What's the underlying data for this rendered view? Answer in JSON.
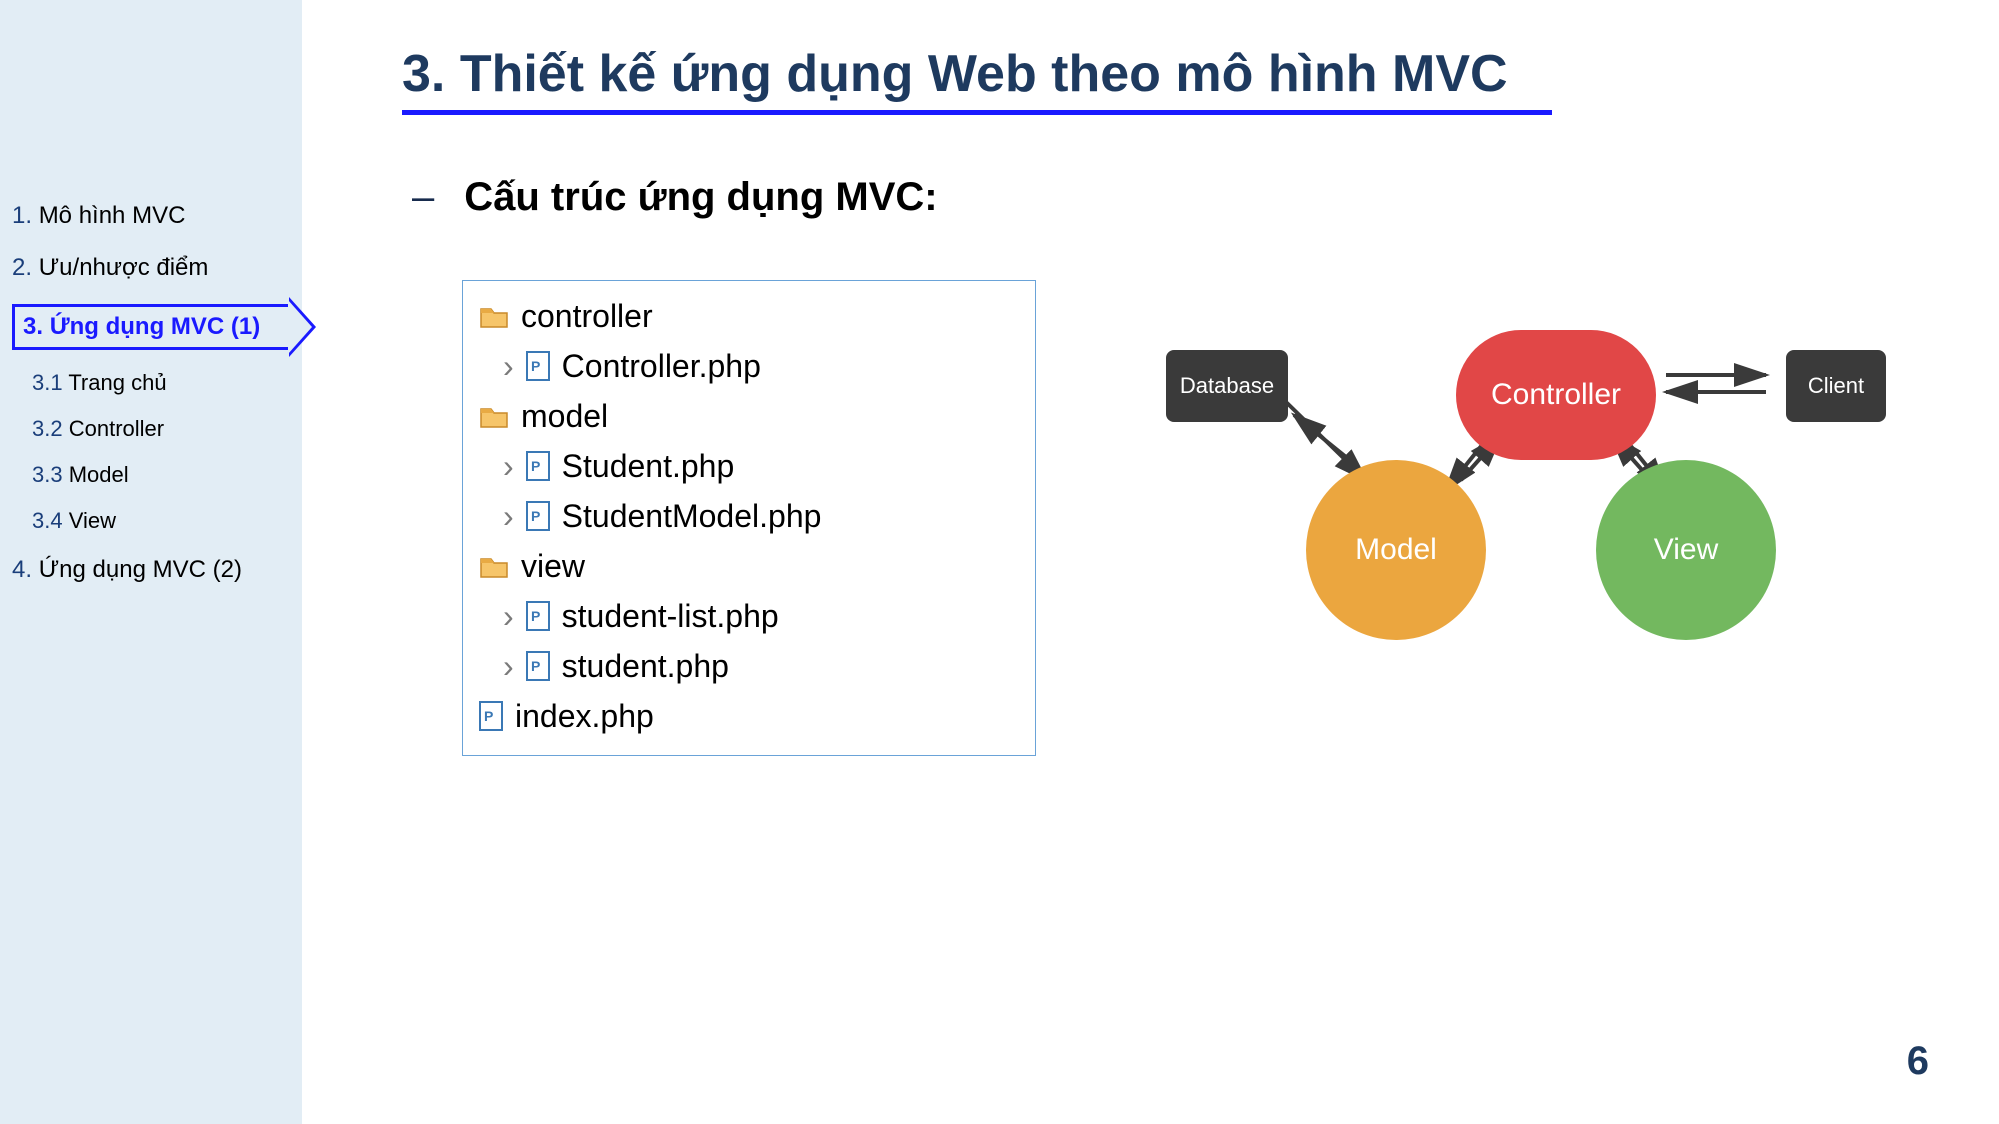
{
  "sidebar": {
    "items": [
      {
        "num": "1.",
        "label": "Mô hình MVC"
      },
      {
        "num": "2.",
        "label": "Ưu/nhược điểm"
      },
      {
        "num": "3.",
        "label": "Ứng dụng MVC (1)"
      },
      {
        "num": "4.",
        "label": "Ứng dụng MVC (2)"
      }
    ],
    "subs": [
      {
        "num": "3.1",
        "label": "Trang chủ"
      },
      {
        "num": "3.2",
        "label": "Controller"
      },
      {
        "num": "3.3",
        "label": "Model"
      },
      {
        "num": "3.4",
        "label": "View"
      }
    ]
  },
  "title": "3. Thiết kế ứng dụng Web theo mô hình MVC",
  "subtitle_dash": "–",
  "subtitle": "Cấu trúc ứng dụng MVC:",
  "tree": {
    "folders": [
      "controller",
      "model",
      "view"
    ],
    "files": {
      "controller": [
        "Controller.php"
      ],
      "model": [
        "Student.php",
        "StudentModel.php"
      ],
      "view": [
        "student-list.php",
        "student.php"
      ]
    },
    "root_file": "index.php"
  },
  "diagram": {
    "database": "Database",
    "client": "Client",
    "controller": "Controller",
    "model": "Model",
    "view": "View"
  },
  "page_number": "6"
}
